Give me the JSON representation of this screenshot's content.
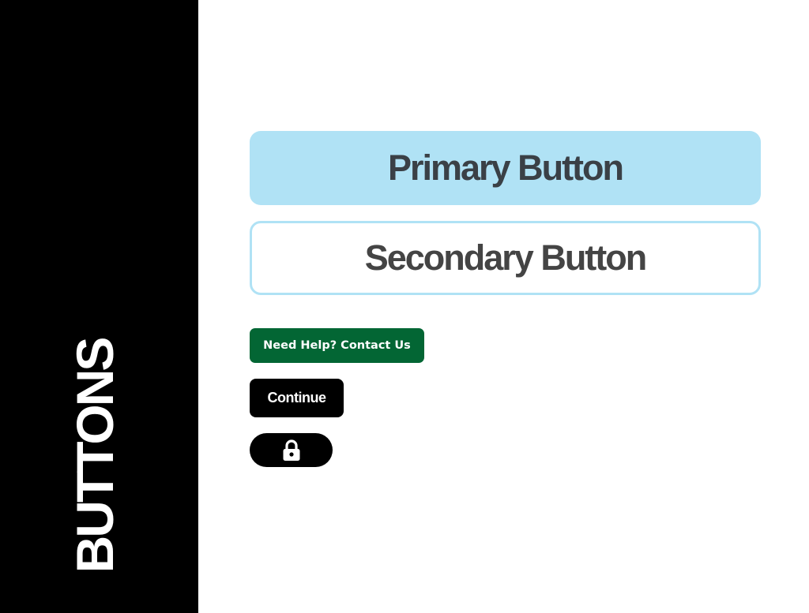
{
  "sidebar": {
    "title": "BUTTONS"
  },
  "buttons": {
    "primary_label": "Primary Button",
    "secondary_label": "Secondary Button",
    "help_label": "Need Help? Contact Us",
    "continue_label": "Continue",
    "lock_icon": "lock-icon"
  },
  "colors": {
    "sidebar_bg": "#000000",
    "primary_bg": "#b0e2f5",
    "primary_text": "#3a4046",
    "secondary_border": "#b0e2f5",
    "secondary_text": "#444444",
    "help_bg": "#036634",
    "dark_button_bg": "#000000",
    "button_text_light": "#ffffff"
  }
}
